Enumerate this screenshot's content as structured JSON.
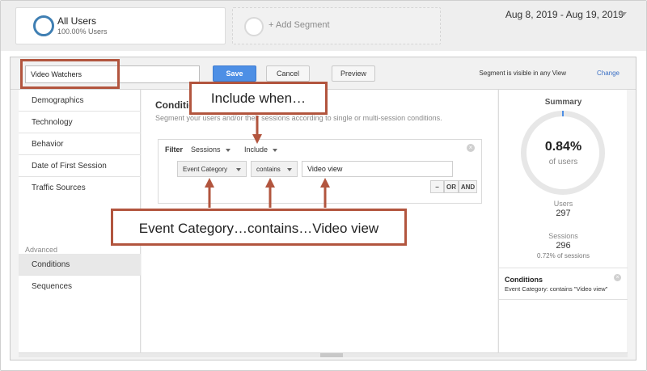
{
  "segments": {
    "active": {
      "name": "All Users",
      "subtitle": "100.00% Users"
    },
    "add_label": "+ Add Segment"
  },
  "date_range": "Aug 8, 2019 - Aug 19, 2019",
  "editor": {
    "segment_name": "Video Watchers",
    "save_label": "Save",
    "cancel_label": "Cancel",
    "preview_label": "Preview",
    "visibility_text": "Segment is visible in any View",
    "change_label": "Change"
  },
  "sidebar": {
    "items": [
      {
        "label": "Demographics"
      },
      {
        "label": "Technology"
      },
      {
        "label": "Behavior"
      },
      {
        "label": "Date of First Session"
      },
      {
        "label": "Traffic Sources"
      }
    ],
    "advanced_label": "Advanced",
    "advanced_items": [
      {
        "label": "Conditions",
        "active": true
      },
      {
        "label": "Sequences"
      }
    ]
  },
  "conditions": {
    "title": "Conditio",
    "description": "Segment your users and/or their sessions according to single or multi-session conditions.",
    "filter": {
      "label": "Filter",
      "scope": "Sessions",
      "mode": "Include",
      "dimension": "Event Category",
      "operator": "contains",
      "value": "Video view",
      "minus_label": "−",
      "or_label": "OR",
      "and_label": "AND",
      "close_symbol": "×"
    }
  },
  "summary": {
    "title": "Summary",
    "percent": "0.84%",
    "percent_label": "of users",
    "percent_value": 0.84,
    "users_label": "Users",
    "users_value": "297",
    "sessions_label": "Sessions",
    "sessions_value": "296",
    "sessions_note": "0.72% of sessions",
    "conditions_title": "Conditions",
    "conditions_desc": "Event Category: contains \"Video view\"",
    "close_symbol": "×"
  },
  "annotations": {
    "callout_include": "Include when…",
    "callout_condition": "Event Category…contains…Video view"
  },
  "colors": {
    "accent": "#4d8fe5",
    "annotation": "#b2553e",
    "segment_ring": "#3f7fb3"
  }
}
